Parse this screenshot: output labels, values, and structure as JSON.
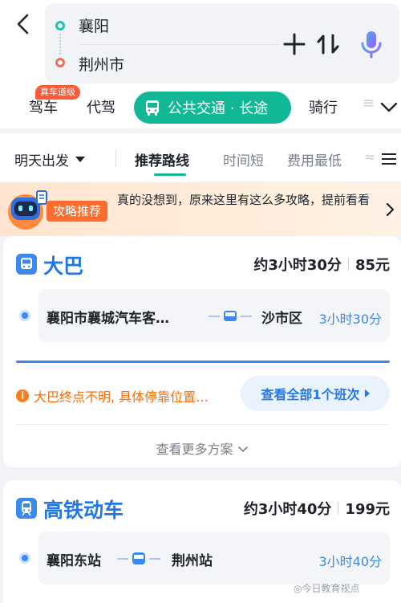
{
  "route": {
    "from": "襄阳",
    "to": "荆州市"
  },
  "modes": {
    "drive": "驾车",
    "drive_badge": "真车道级",
    "chauffeur": "代驾",
    "transit": "公共交通 · 长途",
    "ride": "骑行",
    "cut": "≡"
  },
  "filters": {
    "depart": "明天出发",
    "tabs": [
      "推荐路线",
      "时间短",
      "费用最低",
      "≈"
    ]
  },
  "promo": {
    "tag": "攻略推荐",
    "text": "真的没想到，原来这里有这么多攻略，提前看看"
  },
  "bus": {
    "title": "大巴",
    "duration": "约3小时30分",
    "price": "85元",
    "from": "襄阳市襄城汽车客…",
    "to": "沙市区",
    "seg_duration": "3小时30分",
    "warning": "大巴终点不明, 具体停靠位置…",
    "view_all": "查看全部1个班次"
  },
  "more_plans": "查看更多方案",
  "rail": {
    "title": "高铁动车",
    "duration": "约3小时40分",
    "price": "199元",
    "from": "襄阳东站",
    "to": "荆州站",
    "seg_duration": "3小时40分"
  },
  "watermark": "今日教育视点",
  "colors": {
    "accent": "#12b896",
    "blue": "#2277e8",
    "warning": "#ff6a00"
  }
}
